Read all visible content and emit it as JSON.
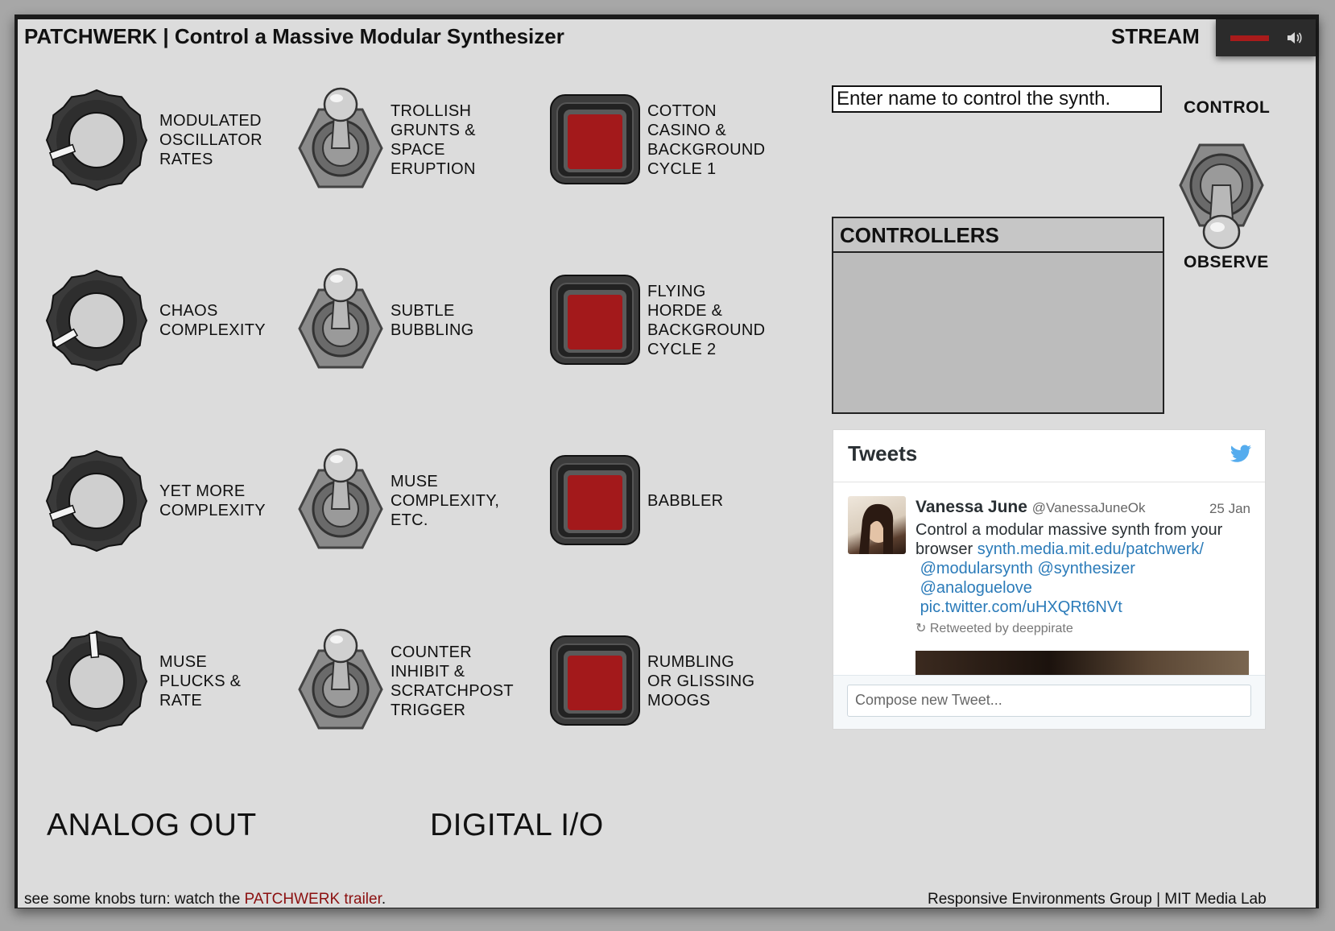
{
  "header": {
    "title": "PATCHWERK | Control a Massive Modular Synthesizer",
    "stream_label": "STREAM",
    "stream_bar_color": "#a91b1b",
    "speaker_icon": "speaker-icon"
  },
  "analog": {
    "section_label": "ANALOG OUT",
    "knobs": [
      {
        "lines": [
          "MODULATED",
          "OSCILLATOR",
          "RATES"
        ]
      },
      {
        "lines": [
          "CHAOS",
          "COMPLEXITY"
        ]
      },
      {
        "lines": [
          "YET MORE",
          "COMPLEXITY"
        ]
      },
      {
        "lines": [
          "MUSE",
          "PLUCKS &",
          "RATE"
        ]
      }
    ]
  },
  "digital": {
    "section_label": "DIGITAL I/O",
    "toggles": [
      {
        "lines": [
          "TROLLISH",
          "GRUNTS &",
          "SPACE",
          "ERUPTION"
        ]
      },
      {
        "lines": [
          "SUBTLE",
          "BUBBLING"
        ]
      },
      {
        "lines": [
          "MUSE",
          "COMPLEXITY,",
          "ETC."
        ]
      },
      {
        "lines": [
          "COUNTER",
          "INHIBIT &",
          "SCRATCHPOST",
          "TRIGGER"
        ]
      }
    ],
    "buttons": [
      {
        "lines": [
          "COTTON",
          "CASINO &",
          "BACKGROUND",
          "CYCLE 1"
        ]
      },
      {
        "lines": [
          "FLYING",
          "HORDE &",
          "BACKGROUND",
          "CYCLE 2"
        ]
      },
      {
        "lines": [
          "BABBLER"
        ]
      },
      {
        "lines": [
          "RUMBLING",
          "OR GLISSING",
          "MOOGS"
        ]
      }
    ],
    "button_color": "#a3191b"
  },
  "control": {
    "name_placeholder": "Enter name to control the synth.",
    "control_label": "CONTROL",
    "observe_label": "OBSERVE",
    "controllers_title": "CONTROLLERS"
  },
  "tweets": {
    "title": "Tweets",
    "bird_icon": "twitter-bird-icon",
    "tweet": {
      "name": "Vanessa June",
      "handle": "@VanessaJuneOk",
      "date": "25 Jan",
      "text": "Control a modular massive synth from your browser",
      "links": [
        "synth.media.mit.edu/patchwerk/",
        "@modularsynth",
        "@synthesizer",
        "@analoguelove",
        "pic.twitter.com/uHXQRt6NVt"
      ],
      "retweet_text": "Retweeted by deeppirate"
    },
    "compose_placeholder": "Compose new Tweet..."
  },
  "footer": {
    "prefix": "see some knobs turn: watch the ",
    "link": "PATCHWERK trailer",
    "suffix": ".",
    "credit": "Responsive Environments Group | MIT Media Lab"
  }
}
